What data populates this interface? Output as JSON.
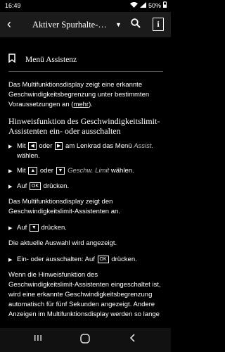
{
  "status": {
    "time": "16:49",
    "battery": "50%"
  },
  "appbar": {
    "title": "Aktiver Spurhalte-Assistent"
  },
  "section": {
    "title": "Menü Assistenz"
  },
  "intro": {
    "a": "Das Multifunktionsdisplay zeigt eine erkannte Geschwindigkeitsbegrenzung unter bestimmten Voraussetzungen an (",
    "link": "mehr",
    "b": ")."
  },
  "heading": "Hinweisfunktion des Geschwindigkeitslimit-Assistenten ein- oder ausschalten",
  "step1": {
    "a": "Mit",
    "or": "oder",
    "b": "am Lenkrad das Menü",
    "italic": "Assist.",
    "c": "wählen."
  },
  "step2": {
    "a": "Mit",
    "or": "oder",
    "italic": "Geschw. Limit",
    "b": "wählen."
  },
  "step3": {
    "a": "Auf",
    "key": "OK",
    "b": "drücken."
  },
  "note1": "Das Multifunktionsdisplay zeigt den Geschwindigkeitslimit-Assistenten an.",
  "step4": {
    "a": "Auf",
    "b": "drücken."
  },
  "note2": "Die aktuelle Auswahl wird angezeigt.",
  "step5": {
    "a": "Ein- oder ausschalten: Auf",
    "key": "OK",
    "b": "drücken."
  },
  "para": "Wenn die Hinweisfunktion des Geschwindigkeitslimit-Assistenten eingeschaltet ist, wird eine erkannte Geschwindigkeitsbegrenzung automatisch für fünf Sekunden angezeigt. Andere Anzeigen im Multifunktionsdisplay werden so lange"
}
